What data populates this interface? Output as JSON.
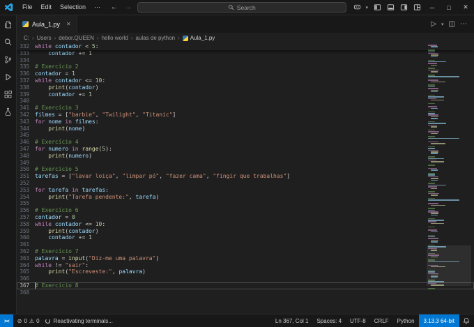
{
  "titlebar": {
    "menus": [
      "File",
      "Edit",
      "Selection",
      "⋯"
    ],
    "nav_back": "←",
    "nav_forward": "→",
    "search_placeholder": "Search",
    "right_icon_names": [
      "copilot-icon",
      "toggle-primary-sidebar-icon",
      "toggle-panel-icon",
      "toggle-secondary-sidebar-icon",
      "customize-layout-icon"
    ],
    "window_controls": {
      "minimize": "─",
      "maximize": "□",
      "close": "✕"
    }
  },
  "activity_bar": {
    "icon_names": [
      "explorer-icon",
      "search-icon",
      "source-control-icon",
      "run-debug-icon",
      "extensions-icon",
      "testing-icon"
    ]
  },
  "editor_header": {
    "tab": {
      "label": "Aula_1.py",
      "close": "✕"
    },
    "actions": {
      "run": "▷",
      "dropdown": "▾",
      "split": "◫",
      "more": "⋯"
    },
    "breadcrumbs": [
      "C:",
      "Users",
      "debor.QUEEN",
      "hello world",
      "aulas de python",
      "Aula_1.py"
    ]
  },
  "editor": {
    "token_colors": {
      "kw": "#C586C0",
      "var": "#9CDCFE",
      "op": "#D4D4D4",
      "num": "#B5CEA8",
      "str": "#CE9178",
      "com": "#6A9955",
      "fn": "#DCDCAA",
      "txt": "#D4D4D4"
    },
    "lines": [
      {
        "n": 332,
        "sticky": true,
        "t": [
          [
            "kw",
            "while "
          ],
          [
            "var",
            "contador "
          ],
          [
            "op",
            "< "
          ],
          [
            "num",
            "5"
          ],
          [
            "txt",
            ":"
          ]
        ]
      },
      {
        "n": 333,
        "t": [
          [
            "var",
            "    contador "
          ],
          [
            "op",
            "+= "
          ],
          [
            "num",
            "1"
          ]
        ]
      },
      {
        "n": 334,
        "t": []
      },
      {
        "n": 335,
        "t": [
          [
            "com",
            "# Exercício 2"
          ]
        ]
      },
      {
        "n": 336,
        "t": [
          [
            "var",
            "contador "
          ],
          [
            "op",
            "= "
          ],
          [
            "num",
            "1"
          ]
        ]
      },
      {
        "n": 337,
        "t": [
          [
            "kw",
            "while "
          ],
          [
            "var",
            "contador "
          ],
          [
            "op",
            "<= "
          ],
          [
            "num",
            "10"
          ],
          [
            "txt",
            ":"
          ]
        ]
      },
      {
        "n": 338,
        "t": [
          [
            "fn",
            "    print"
          ],
          [
            "txt",
            "("
          ],
          [
            "var",
            "contador"
          ],
          [
            "txt",
            ")"
          ]
        ]
      },
      {
        "n": 339,
        "t": [
          [
            "var",
            "    contador "
          ],
          [
            "op",
            "+= "
          ],
          [
            "num",
            "1"
          ]
        ]
      },
      {
        "n": 340,
        "t": []
      },
      {
        "n": 341,
        "t": [
          [
            "com",
            "# Exercício 3"
          ]
        ]
      },
      {
        "n": 342,
        "t": [
          [
            "var",
            "filmes "
          ],
          [
            "op",
            "= "
          ],
          [
            "txt",
            "["
          ],
          [
            "str",
            "\"barbie\""
          ],
          [
            "txt",
            ", "
          ],
          [
            "str",
            "\"Twilight\""
          ],
          [
            "txt",
            ", "
          ],
          [
            "str",
            "\"Titanic\""
          ],
          [
            "txt",
            "]"
          ]
        ]
      },
      {
        "n": 343,
        "t": [
          [
            "kw",
            "for "
          ],
          [
            "var",
            "nome "
          ],
          [
            "kw",
            "in "
          ],
          [
            "var",
            "filmes"
          ],
          [
            "txt",
            ":"
          ]
        ]
      },
      {
        "n": 344,
        "t": [
          [
            "fn",
            "    print"
          ],
          [
            "txt",
            "("
          ],
          [
            "var",
            "nome"
          ],
          [
            "txt",
            ")"
          ]
        ]
      },
      {
        "n": 345,
        "t": []
      },
      {
        "n": 346,
        "t": [
          [
            "com",
            "# Exercício 4"
          ]
        ]
      },
      {
        "n": 347,
        "t": [
          [
            "kw",
            "for "
          ],
          [
            "var",
            "numero "
          ],
          [
            "kw",
            "in "
          ],
          [
            "fn",
            "range"
          ],
          [
            "txt",
            "("
          ],
          [
            "num",
            "5"
          ],
          [
            "txt",
            "):"
          ]
        ]
      },
      {
        "n": 348,
        "t": [
          [
            "fn",
            "    print"
          ],
          [
            "txt",
            "("
          ],
          [
            "var",
            "numero"
          ],
          [
            "txt",
            ")"
          ]
        ]
      },
      {
        "n": 349,
        "t": []
      },
      {
        "n": 350,
        "t": [
          [
            "com",
            "# Exercício 5"
          ]
        ]
      },
      {
        "n": 351,
        "t": [
          [
            "var",
            "tarefas "
          ],
          [
            "op",
            "= "
          ],
          [
            "txt",
            "["
          ],
          [
            "str",
            "\"lavar loiça\""
          ],
          [
            "txt",
            ", "
          ],
          [
            "str",
            "\"limpar pó\""
          ],
          [
            "txt",
            ", "
          ],
          [
            "str",
            "\"fazer cama\""
          ],
          [
            "txt",
            ", "
          ],
          [
            "str",
            "\"fingir que trabalhas\""
          ],
          [
            "txt",
            "]"
          ]
        ]
      },
      {
        "n": 352,
        "t": []
      },
      {
        "n": 353,
        "t": [
          [
            "kw",
            "for "
          ],
          [
            "var",
            "tarefa "
          ],
          [
            "kw",
            "in "
          ],
          [
            "var",
            "tarefas"
          ],
          [
            "txt",
            ":"
          ]
        ]
      },
      {
        "n": 354,
        "t": [
          [
            "fn",
            "    print"
          ],
          [
            "txt",
            "("
          ],
          [
            "str",
            "\"Tarefa pendente:\""
          ],
          [
            "txt",
            ", "
          ],
          [
            "var",
            "tarefa"
          ],
          [
            "txt",
            ")"
          ]
        ]
      },
      {
        "n": 355,
        "t": []
      },
      {
        "n": 356,
        "t": [
          [
            "com",
            "# Exercício 6"
          ]
        ]
      },
      {
        "n": 357,
        "t": [
          [
            "var",
            "contador "
          ],
          [
            "op",
            "= "
          ],
          [
            "num",
            "0"
          ]
        ]
      },
      {
        "n": 358,
        "t": [
          [
            "kw",
            "while "
          ],
          [
            "var",
            "contador "
          ],
          [
            "op",
            "<= "
          ],
          [
            "num",
            "10"
          ],
          [
            "txt",
            ":"
          ]
        ]
      },
      {
        "n": 359,
        "t": [
          [
            "fn",
            "    print"
          ],
          [
            "txt",
            "("
          ],
          [
            "var",
            "contador"
          ],
          [
            "txt",
            ")"
          ]
        ]
      },
      {
        "n": 360,
        "t": [
          [
            "var",
            "    contador "
          ],
          [
            "op",
            "+= "
          ],
          [
            "num",
            "1"
          ]
        ]
      },
      {
        "n": 361,
        "t": []
      },
      {
        "n": 362,
        "t": [
          [
            "com",
            "# Exercício 7"
          ]
        ]
      },
      {
        "n": 363,
        "t": [
          [
            "var",
            "palavra "
          ],
          [
            "op",
            "= "
          ],
          [
            "fn",
            "input"
          ],
          [
            "txt",
            "("
          ],
          [
            "str",
            "\"Diz-me uma palavra\""
          ],
          [
            "txt",
            ")"
          ]
        ]
      },
      {
        "n": 364,
        "t": [
          [
            "kw",
            "while "
          ],
          [
            "op",
            "!= "
          ],
          [
            "str",
            "\"sair\""
          ],
          [
            "txt",
            ":"
          ]
        ]
      },
      {
        "n": 365,
        "t": [
          [
            "fn",
            "    print"
          ],
          [
            "txt",
            "("
          ],
          [
            "str",
            "\"Escreveste:\""
          ],
          [
            "txt",
            ", "
          ],
          [
            "var",
            "palavra"
          ],
          [
            "txt",
            ")"
          ]
        ]
      },
      {
        "n": 366,
        "t": []
      },
      {
        "n": 367,
        "current": true,
        "t": [
          [
            "com",
            "# Exercício 8"
          ]
        ]
      },
      {
        "n": 368,
        "t": []
      }
    ]
  },
  "minimap": {
    "repeat": 4
  },
  "status_bar": {
    "remote": "><",
    "errors_icon": "⊘",
    "errors": "0",
    "warnings_icon": "⚠",
    "warnings": "0",
    "message": "Reactivating terminals...",
    "right_items": [
      "Ln 367, Col 1",
      "Spaces: 4",
      "UTF-8",
      "CRLF",
      "Python"
    ],
    "python_version": "3.13.3 64-bit"
  }
}
